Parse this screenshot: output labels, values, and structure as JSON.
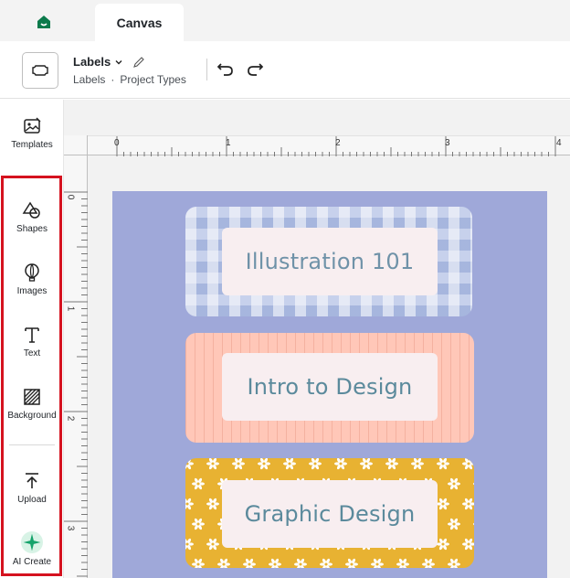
{
  "tabbar": {
    "tab_label": "Canvas"
  },
  "header": {
    "project_title": "Labels",
    "breadcrumb": [
      "Labels",
      "·",
      "Project Types"
    ]
  },
  "sidebar": {
    "items": [
      {
        "label": "Templates",
        "icon": "templates-icon"
      },
      {
        "label": "Shapes",
        "icon": "shapes-icon"
      },
      {
        "label": "Images",
        "icon": "images-icon"
      },
      {
        "label": "Text",
        "icon": "text-icon"
      },
      {
        "label": "Background",
        "icon": "background-icon"
      },
      {
        "label": "Upload",
        "icon": "upload-icon"
      },
      {
        "label": "AI Create",
        "icon": "ai-create-icon"
      }
    ]
  },
  "ruler": {
    "top": [
      "0",
      "1",
      "2",
      "3",
      "4"
    ],
    "left": [
      "0",
      "1",
      "2",
      "3"
    ]
  },
  "canvas": {
    "labels": [
      {
        "text": "Illustration 101"
      },
      {
        "text": "Intro to Design"
      },
      {
        "text": "Graphic Design"
      }
    ]
  },
  "colors": {
    "brand": "#0b7a4b",
    "highlight": "#d5121f",
    "mat": "#9fa8d9",
    "gingham": "#c7d1ec",
    "peach": "#ffc7b8",
    "mustard": "#e8b232",
    "label_text": "#5b8a9c"
  }
}
